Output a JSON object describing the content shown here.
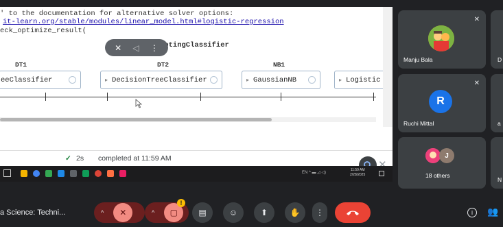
{
  "notebook": {
    "line1": "' to the documentation for alternative solver options:",
    "line2": "it-learn.org/stable/modules/linear_model.html#logistic-regression",
    "line3": "eck_optimize_result(",
    "classifier_title": "VotingClassifier",
    "estimators": [
      {
        "label": "DT1",
        "name": "eeClassifier"
      },
      {
        "label": "DT2",
        "name": "DecisionTreeClassifier"
      },
      {
        "label": "NB1",
        "name": "GaussianNB"
      },
      {
        "label": "",
        "name": "Logistic"
      }
    ],
    "status": {
      "check": "✓",
      "duration": "2s",
      "completed": "completed at 11:59 AM"
    }
  },
  "taskbar": {
    "tray_text": "EN  ^  ▬  ◿  ◁)",
    "time": "11:59 AM",
    "date": "2/28/2025"
  },
  "participants": [
    {
      "name": "Manju Bala",
      "avatar_type": "photo",
      "muted": true
    },
    {
      "name": "Ruchi Mittal",
      "initial": "R",
      "avatar_color": "#1a73e8",
      "muted": true
    },
    {
      "name": "18 others",
      "initial": "J",
      "avatar_color": "#8e7b6e"
    }
  ],
  "side_partial": {
    "label_1": "D",
    "label_2": "a",
    "label_3": "N"
  },
  "controls": {
    "meeting_title": "a Science: Techni...",
    "warning_badge": "!"
  },
  "colors": {
    "accent_red": "#ea4335",
    "muted_bg": "#6b1f1f",
    "tile_bg": "#3c4043",
    "avatar_blue": "#1a73e8"
  }
}
